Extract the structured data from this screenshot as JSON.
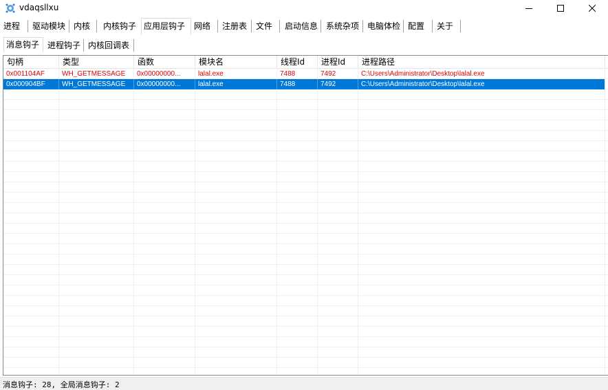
{
  "window": {
    "title": "vdaqsllxu"
  },
  "main_tabs": [
    "进程",
    "驱动模块",
    "内核",
    "内核钩子",
    "应用层钩子",
    "网络",
    "注册表",
    "文件",
    "启动信息",
    "系统杂项",
    "电脑体检",
    "配置",
    "关于"
  ],
  "active_main_tab": "应用层钩子",
  "sub_tabs": [
    "消息钩子",
    "进程钩子",
    "内核回调表"
  ],
  "active_sub_tab": "消息钩子",
  "table": {
    "columns": [
      "句柄",
      "类型",
      "函数",
      "模块名",
      "线程Id",
      "进程Id",
      "进程路径"
    ],
    "rows": [
      [
        "0x001104AF",
        "WH_GETMESSAGE",
        "0x00000000...",
        "lalal.exe",
        "7488",
        "7492",
        "C:\\Users\\Administrator\\Desktop\\lalal.exe"
      ],
      [
        "0x000904BF",
        "WH_GETMESSAGE",
        "0x00000000...",
        "lalal.exe",
        "7488",
        "7492",
        "C:\\Users\\Administrator\\Desktop\\lalal.exe"
      ]
    ],
    "selected_row": 1
  },
  "status": {
    "text": "消息钩子: 28, 全局消息钩子: 2"
  },
  "colors": {
    "selection": "#0078d7",
    "highlight_text": "#e00000"
  }
}
